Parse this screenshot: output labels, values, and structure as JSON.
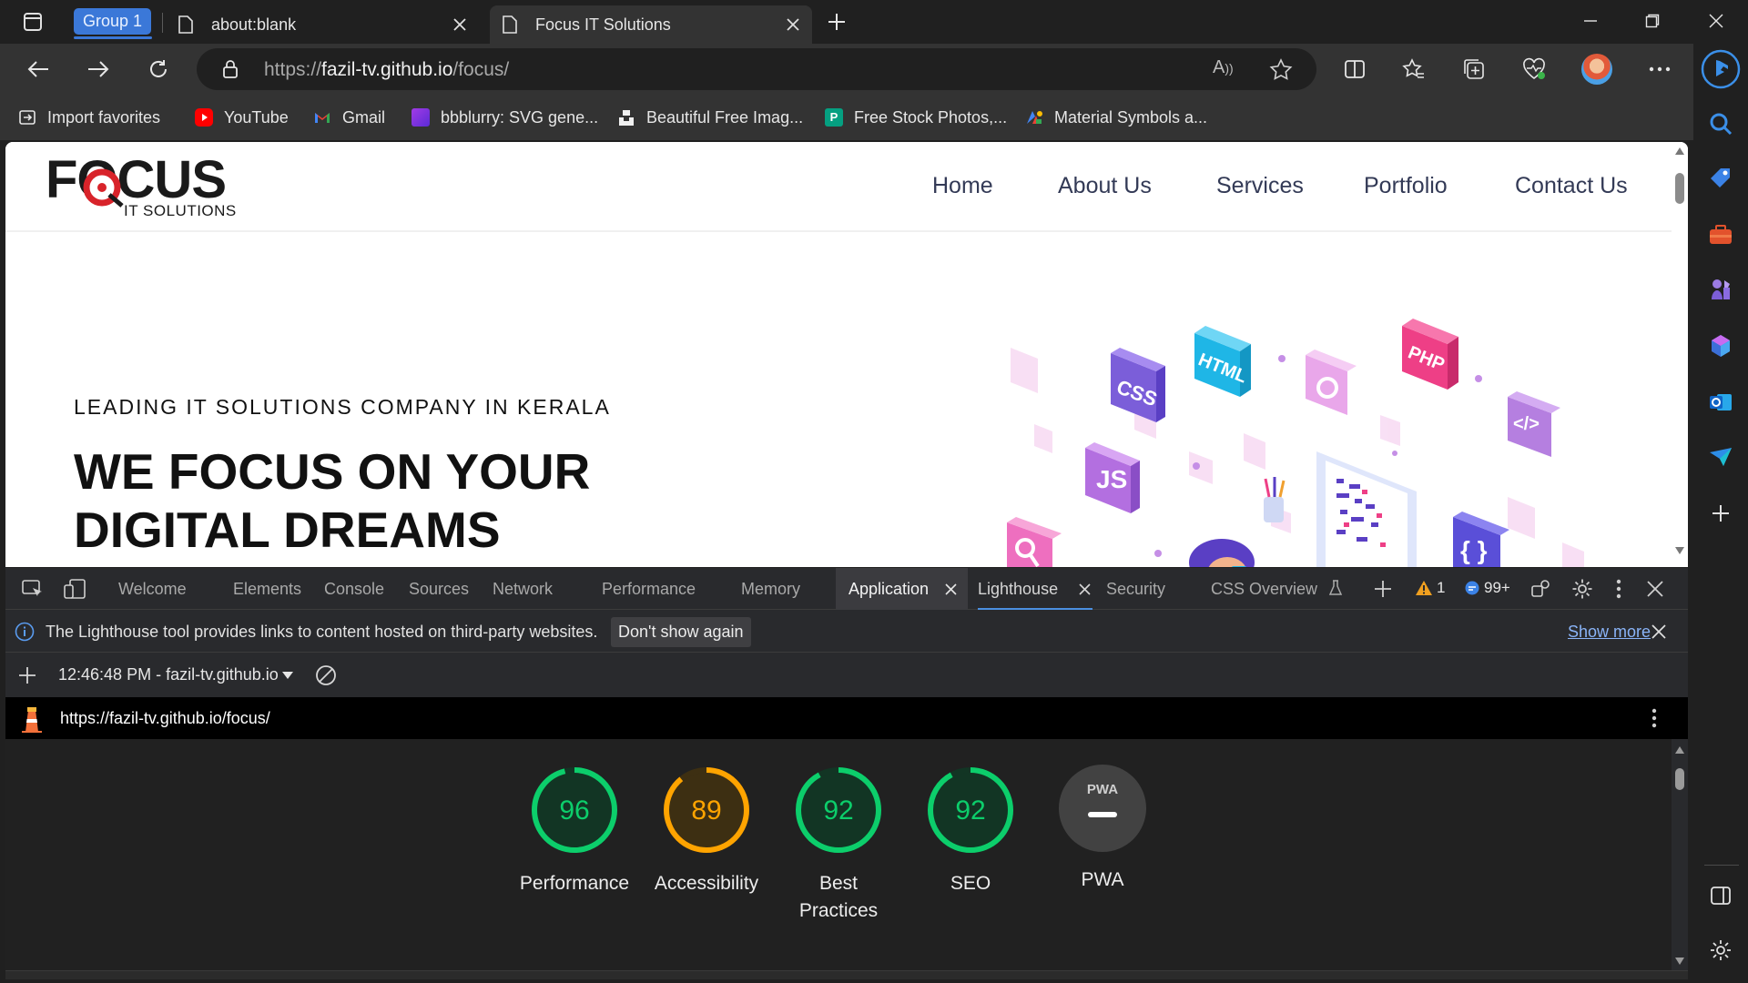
{
  "browser": {
    "tab_group_label": "Group 1",
    "tabs": [
      {
        "title": "about:blank"
      },
      {
        "title": "Focus IT Solutions"
      }
    ],
    "url_prefix": "https://",
    "url_host": "fazil-tv.github.io",
    "url_path": "/focus/"
  },
  "bookmarks": [
    {
      "label": "Import favorites",
      "icon": "import-icon"
    },
    {
      "label": "YouTube",
      "icon": "youtube-icon",
      "color": "#ff0000"
    },
    {
      "label": "Gmail",
      "icon": "gmail-icon",
      "color": "#ea4335"
    },
    {
      "label": "bbblurry: SVG gene...",
      "icon": "bbblurry-icon",
      "color": "#7b3fe4"
    },
    {
      "label": "Beautiful Free Imag...",
      "icon": "unsplash-icon",
      "color": "#111111"
    },
    {
      "label": "Free Stock Photos,...",
      "icon": "pexels-icon",
      "color": "#05a081"
    },
    {
      "label": "Material Symbols a...",
      "icon": "google-fonts-icon",
      "color": "#4285f4"
    }
  ],
  "website": {
    "logo_text": "FOCUS",
    "logo_subtext": "IT SOLUTIONS",
    "nav": [
      "Home",
      "About Us",
      "Services",
      "Portfolio",
      "Contact Us"
    ],
    "hero_subtitle": "LEADING IT SOLUTIONS COMPANY IN KERALA",
    "hero_title_line1": "WE FOCUS ON YOUR",
    "hero_title_line2": "DIGITAL DREAMS",
    "illustration_tiles": [
      "CSS",
      "HTML",
      "PHP",
      "JS",
      "</>",
      "{ }"
    ]
  },
  "devtools": {
    "tabs": [
      "Welcome",
      "Elements",
      "Console",
      "Sources",
      "Network",
      "Performance",
      "Memory",
      "Application",
      "Lighthouse",
      "Security",
      "CSS Overview"
    ],
    "active_tab": "Application",
    "warnings_count": "1",
    "messages_count": "99+",
    "info_message": "The Lighthouse tool provides links to content hosted on third-party websites.",
    "dont_show_label": "Don't show again",
    "show_more_label": "Show more",
    "report_selector": "12:46:48 PM - fazil-tv.github.io",
    "report_url": "https://fazil-tv.github.io/focus/",
    "scores": [
      {
        "label": "Performance",
        "value": "96",
        "score": 96,
        "color": "#0cce6b"
      },
      {
        "label": "Accessibility",
        "value": "89",
        "score": 89,
        "color": "#ffa400"
      },
      {
        "label": "Best Practices",
        "value": "92",
        "score": 92,
        "color": "#0cce6b"
      },
      {
        "label": "SEO",
        "value": "92",
        "score": 92,
        "color": "#0cce6b"
      }
    ],
    "pwa": {
      "label": "PWA",
      "badge": "PWA"
    }
  }
}
